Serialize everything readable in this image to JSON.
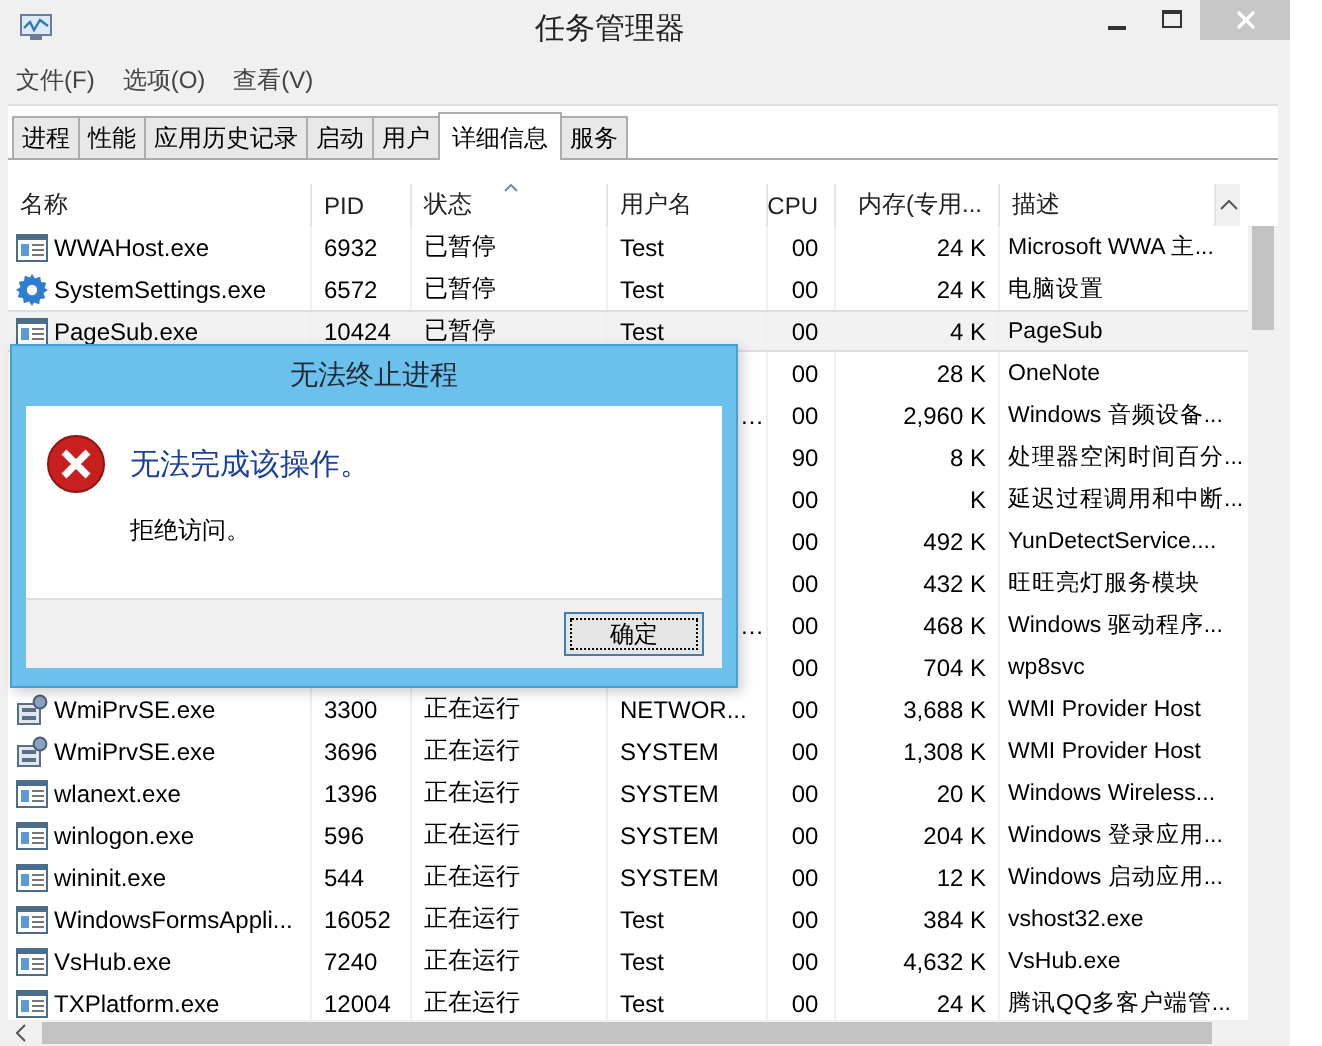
{
  "window": {
    "title": "任务管理器"
  },
  "menu": [
    "文件(F)",
    "选项(O)",
    "查看(V)"
  ],
  "tabs": [
    {
      "label": "进程",
      "selected": false
    },
    {
      "label": "性能",
      "selected": false
    },
    {
      "label": "应用历史记录",
      "selected": false
    },
    {
      "label": "启动",
      "selected": false
    },
    {
      "label": "用户",
      "selected": false
    },
    {
      "label": "详细信息",
      "selected": true
    },
    {
      "label": "服务",
      "selected": false
    }
  ],
  "table": {
    "columns": [
      {
        "label": "名称",
        "sorted": false
      },
      {
        "label": "PID",
        "sorted": false
      },
      {
        "label": "状态",
        "sorted": true
      },
      {
        "label": "用户名",
        "sorted": false
      },
      {
        "label": "CPU",
        "sorted": false
      },
      {
        "label": "内存(专用...",
        "sorted": false
      },
      {
        "label": "描述",
        "sorted": false
      }
    ],
    "rows": [
      {
        "kind": "app",
        "name": "WWAHost.exe",
        "pid": "6932",
        "status": "已暂停",
        "user": "Test",
        "cpu": "00",
        "memory": "24 K",
        "description": "Microsoft WWA 主...",
        "selected": false
      },
      {
        "kind": "gear",
        "name": "SystemSettings.exe",
        "pid": "6572",
        "status": "已暂停",
        "user": "Test",
        "cpu": "00",
        "memory": "24 K",
        "description": "电脑设置",
        "selected": false
      },
      {
        "kind": "app",
        "name": "PageSub.exe",
        "pid": "10424",
        "status": "已暂停",
        "user": "Test",
        "cpu": "00",
        "memory": "4 K",
        "description": "PageSub",
        "selected": true
      },
      {
        "cpu": "00",
        "memory": "28 K",
        "description": "OneNote",
        "selected": false
      },
      {
        "user": "…",
        "cpu": "00",
        "memory": "2,960 K",
        "description": "Windows 音频设备...",
        "selected": false
      },
      {
        "cpu": "90",
        "memory": "8 K",
        "description": "处理器空闲时间百分...",
        "selected": false
      },
      {
        "cpu": "00",
        "memory": "K",
        "description": "延迟过程调用和中断...",
        "selected": false
      },
      {
        "cpu": "00",
        "memory": "492 K",
        "description": "YunDetectService....",
        "selected": false
      },
      {
        "cpu": "00",
        "memory": "432 K",
        "description": "旺旺亮灯服务模块",
        "selected": false
      },
      {
        "user": "…",
        "cpu": "00",
        "memory": "468 K",
        "description": "Windows 驱动程序...",
        "selected": false
      },
      {
        "cpu": "00",
        "memory": "704 K",
        "description": "wp8svc",
        "selected": false
      },
      {
        "kind": "wmi",
        "name": "WmiPrvSE.exe",
        "pid": "3300",
        "status": "正在运行",
        "user": "NETWOR...",
        "cpu": "00",
        "memory": "3,688 K",
        "description": "WMI Provider Host",
        "selected": false
      },
      {
        "kind": "wmi",
        "name": "WmiPrvSE.exe",
        "pid": "3696",
        "status": "正在运行",
        "user": "SYSTEM",
        "cpu": "00",
        "memory": "1,308 K",
        "description": "WMI Provider Host",
        "selected": false
      },
      {
        "kind": "app",
        "name": "wlanext.exe",
        "pid": "1396",
        "status": "正在运行",
        "user": "SYSTEM",
        "cpu": "00",
        "memory": "20 K",
        "description": "Windows Wireless...",
        "selected": false
      },
      {
        "kind": "app",
        "name": "winlogon.exe",
        "pid": "596",
        "status": "正在运行",
        "user": "SYSTEM",
        "cpu": "00",
        "memory": "204 K",
        "description": "Windows 登录应用...",
        "selected": false
      },
      {
        "kind": "app",
        "name": "wininit.exe",
        "pid": "544",
        "status": "正在运行",
        "user": "SYSTEM",
        "cpu": "00",
        "memory": "12 K",
        "description": "Windows 启动应用...",
        "selected": false
      },
      {
        "kind": "app",
        "name": "WindowsFormsAppli...",
        "pid": "16052",
        "status": "正在运行",
        "user": "Test",
        "cpu": "00",
        "memory": "384 K",
        "description": "vshost32.exe",
        "selected": false
      },
      {
        "kind": "app",
        "name": "VsHub.exe",
        "pid": "7240",
        "status": "正在运行",
        "user": "Test",
        "cpu": "00",
        "memory": "4,632 K",
        "description": "VsHub.exe",
        "selected": false
      },
      {
        "kind": "app",
        "name": "TXPlatform.exe",
        "pid": "12004",
        "status": "正在运行",
        "user": "Test",
        "cpu": "00",
        "memory": "24 K",
        "description": "腾讯QQ多客户端管...",
        "selected": false
      }
    ]
  },
  "dialog": {
    "title": "无法终止进程",
    "heading": "无法完成该操作。",
    "message": "拒绝访问。",
    "button": "确定"
  }
}
